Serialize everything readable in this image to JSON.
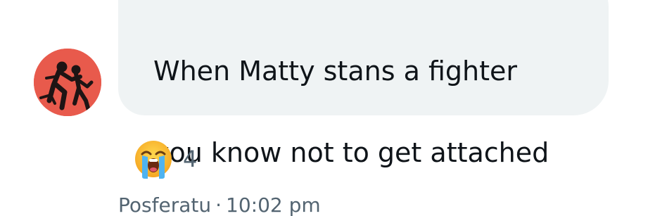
{
  "message": {
    "line1": "When Matty stans a fighter",
    "line2": "you know not to get attached"
  },
  "reaction": {
    "icon": "loudly-crying-face-icon",
    "emoji": "😭",
    "count": "4"
  },
  "meta": {
    "sender": "Posferatu",
    "separator": "·",
    "time": "10:02 pm"
  },
  "colors": {
    "bubble": "#eff3f4",
    "text": "#0f1419",
    "secondary": "#536471",
    "avatar_bg": "#e85a4c"
  }
}
